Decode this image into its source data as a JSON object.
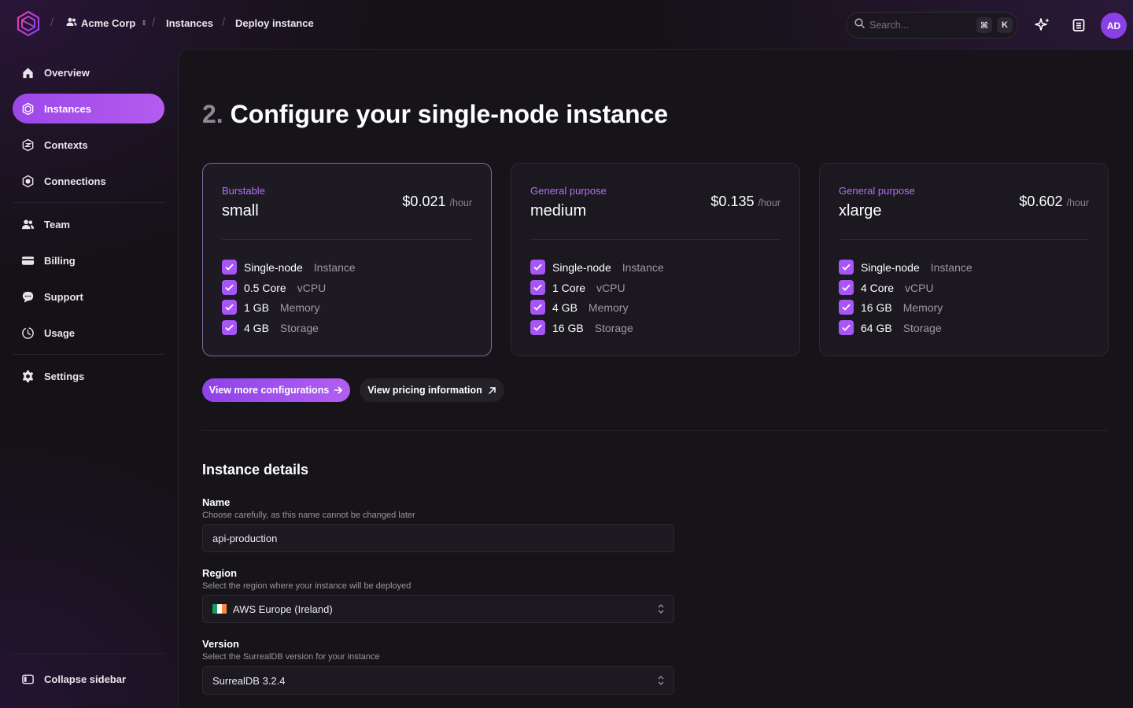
{
  "header": {
    "org": "Acme Corp",
    "breadcrumbs": [
      "Instances",
      "Deploy instance"
    ],
    "search_placeholder": "Search...",
    "shortcut_mod": "⌘",
    "shortcut_key": "K",
    "avatar_initials": "AD"
  },
  "sidebar": {
    "items": [
      {
        "label": "Overview",
        "icon": "home-icon"
      },
      {
        "label": "Instances",
        "icon": "instances-icon",
        "active": true
      },
      {
        "label": "Contexts",
        "icon": "contexts-icon"
      },
      {
        "label": "Connections",
        "icon": "connections-icon"
      },
      {
        "label": "Team",
        "icon": "team-icon"
      },
      {
        "label": "Billing",
        "icon": "billing-icon"
      },
      {
        "label": "Support",
        "icon": "support-icon"
      },
      {
        "label": "Usage",
        "icon": "usage-icon"
      },
      {
        "label": "Settings",
        "icon": "settings-icon"
      }
    ],
    "collapse_label": "Collapse sidebar"
  },
  "main": {
    "step_number": "2.",
    "title": "Configure your single-node instance",
    "cards": [
      {
        "tier": "Burstable",
        "size": "small",
        "price": "$0.021",
        "unit": "/hour",
        "selected": true,
        "features": [
          {
            "value": "Single-node",
            "label": "Instance"
          },
          {
            "value": "0.5 Core",
            "label": "vCPU"
          },
          {
            "value": "1 GB",
            "label": "Memory"
          },
          {
            "value": "4 GB",
            "label": "Storage"
          }
        ]
      },
      {
        "tier": "General purpose",
        "size": "medium",
        "price": "$0.135",
        "unit": "/hour",
        "selected": false,
        "features": [
          {
            "value": "Single-node",
            "label": "Instance"
          },
          {
            "value": "1 Core",
            "label": "vCPU"
          },
          {
            "value": "4 GB",
            "label": "Memory"
          },
          {
            "value": "16 GB",
            "label": "Storage"
          }
        ]
      },
      {
        "tier": "General purpose",
        "size": "xlarge",
        "price": "$0.602",
        "unit": "/hour",
        "selected": false,
        "features": [
          {
            "value": "Single-node",
            "label": "Instance"
          },
          {
            "value": "4 Core",
            "label": "vCPU"
          },
          {
            "value": "16 GB",
            "label": "Memory"
          },
          {
            "value": "64 GB",
            "label": "Storage"
          }
        ]
      }
    ],
    "more_configs_label": "View more configurations",
    "pricing_info_label": "View pricing information",
    "details": {
      "heading": "Instance details",
      "name": {
        "label": "Name",
        "help": "Choose carefully, as this name cannot be changed later",
        "value": "api-production"
      },
      "region": {
        "label": "Region",
        "help": "Select the region where your instance will be deployed",
        "value": "AWS Europe (Ireland)",
        "flag": "ireland-flag-icon"
      },
      "version": {
        "label": "Version",
        "help": "Select the SurrealDB version for your instance",
        "value": "SurrealDB 3.2.4"
      }
    }
  },
  "colors": {
    "accent": "#a855f7",
    "tier_text": "#b070f5",
    "background": "#141216"
  }
}
